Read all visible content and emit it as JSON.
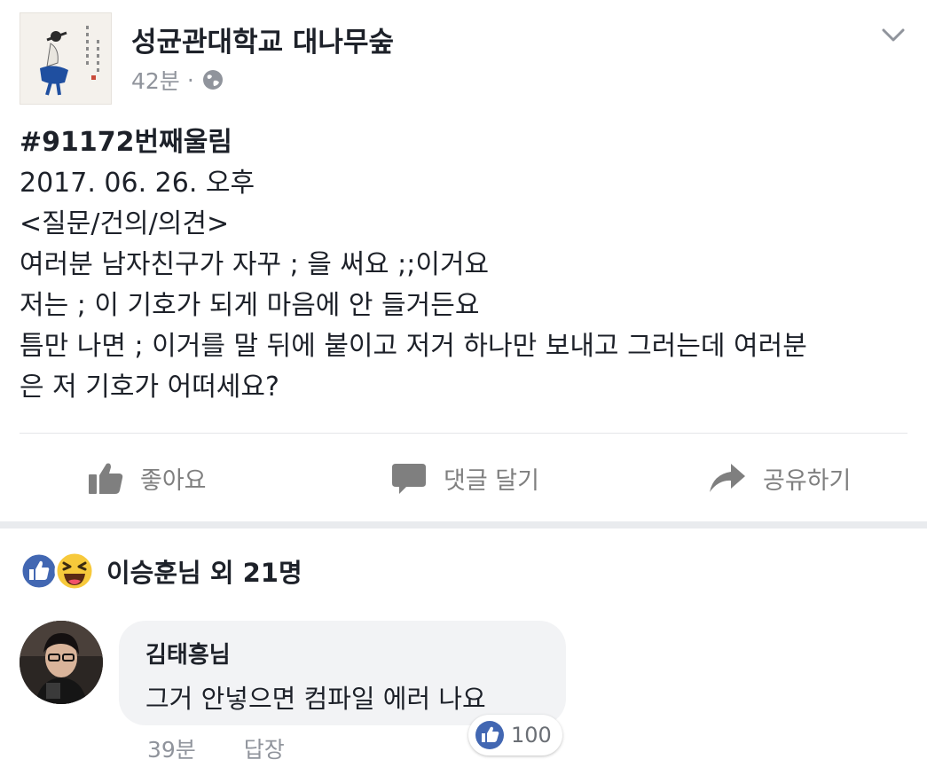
{
  "post": {
    "page_name": "성균관대학교 대나무숲",
    "time": "42분",
    "separator": "·",
    "icons": {
      "privacy": "globe-icon",
      "menu": "chevron-down-icon"
    },
    "lines": [
      "#91172번째울림",
      "2017. 06. 26. 오후",
      "<질문/건의/의견>",
      "여러분 남자친구가 자꾸 ; 을 써요 ;;이거요",
      "저는 ; 이 기호가 되게 마음에 안 들거든요",
      "틈만 나면 ; 이거를 말 뒤에 붙이고 저거 하나만 보내고 그러는데 여러분",
      "은 저 기호가 어떠세요?"
    ]
  },
  "actions": {
    "like": {
      "label": "좋아요",
      "icon": "thumbs-up-icon"
    },
    "comment": {
      "label": "댓글 달기",
      "icon": "speech-bubble-icon"
    },
    "share": {
      "label": "공유하기",
      "icon": "share-arrow-icon"
    }
  },
  "reactions": {
    "summary": "이승훈님 외 21명",
    "icons": [
      "like-reaction-icon",
      "haha-reaction-icon"
    ]
  },
  "comment": {
    "author": "김태흥님",
    "text": "그거 안넣으면 컴파일 에러 나요",
    "likes": "100",
    "time": "39분",
    "reply_label": "답장"
  },
  "colors": {
    "text": "#1d2129",
    "meta": "#90949c",
    "action": "#7f7f7f",
    "facebook_blue": "#4267b2",
    "haha_yellow": "#f7c93b",
    "comment_bubble": "#f2f3f5"
  }
}
